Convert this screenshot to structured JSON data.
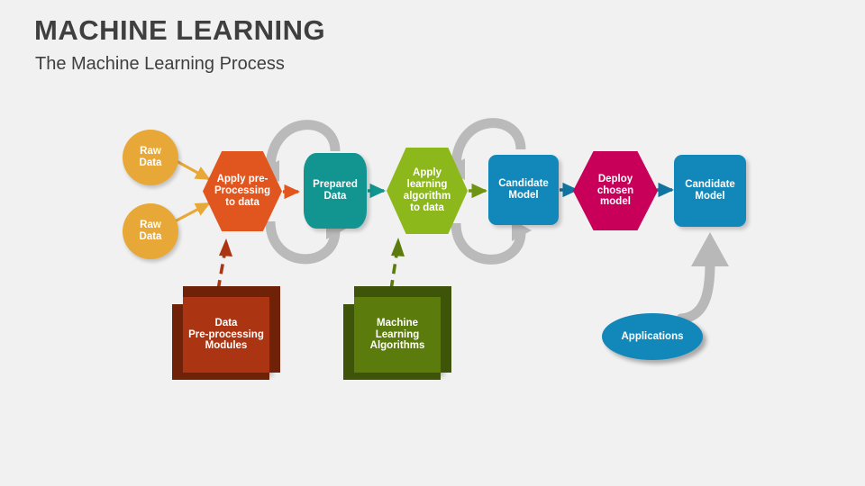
{
  "header": {
    "title": "MACHINE LEARNING",
    "subtitle": "The Machine Learning Process"
  },
  "colors": {
    "background": "#f1f1f1",
    "title_text": "#3f3f3f",
    "raw_data": "#e8a838",
    "preprocess_hex": "#e1561f",
    "prepared_data": "#129490",
    "learning_hex": "#8cb81c",
    "candidate_model": "#1288ba",
    "deploy_hex": "#c8005a",
    "cube_red": "#ab3512",
    "cube_red_dark": "#6f2208",
    "cube_green": "#5b7c0c",
    "cube_green_dark": "#3e5408",
    "applications": "#1288ba",
    "cycle_arrow": "#a6a6a6",
    "node_text": "#ffffff"
  },
  "diagram": {
    "type": "process-flow",
    "nodes": [
      {
        "id": "raw-data-1",
        "label": "Raw\nData",
        "shape": "circle",
        "color": "#e8a838"
      },
      {
        "id": "raw-data-2",
        "label": "Raw\nData",
        "shape": "circle",
        "color": "#e8a838"
      },
      {
        "id": "apply-preprocessing",
        "label": "Apply pre-\nProcessing\nto data",
        "shape": "hexagon",
        "color": "#e1561f"
      },
      {
        "id": "prepared-data",
        "label": "Prepared\nData",
        "shape": "cylinder",
        "color": "#129490"
      },
      {
        "id": "apply-learning-algorithm",
        "label": "Apply\nlearning\nalgorithm\nto data",
        "shape": "hexagon",
        "color": "#8cb81c"
      },
      {
        "id": "candidate-model-1",
        "label": "Candidate\nModel",
        "shape": "rounded-rect",
        "color": "#1288ba"
      },
      {
        "id": "deploy-chosen-model",
        "label": "Deploy\nchosen\nmodel",
        "shape": "hexagon",
        "color": "#c8005a"
      },
      {
        "id": "candidate-model-2",
        "label": "Candidate\nModel",
        "shape": "rounded-rect",
        "color": "#1288ba"
      },
      {
        "id": "data-preprocessing-modules",
        "label": "Data\nPre-processing\nModules",
        "shape": "cube-3d",
        "color": "#ab3512"
      },
      {
        "id": "machine-learning-algorithms",
        "label": "Machine\nLearning\nAlgorithms",
        "shape": "cube-3d",
        "color": "#5b7c0c"
      },
      {
        "id": "applications",
        "label": "Applications",
        "shape": "ellipse",
        "color": "#1288ba"
      }
    ],
    "connectors": [
      {
        "from": "raw-data-1",
        "to": "apply-preprocessing",
        "style": "solid-arrow",
        "color": "#e8a838"
      },
      {
        "from": "raw-data-2",
        "to": "apply-preprocessing",
        "style": "solid-arrow",
        "color": "#e8a838"
      },
      {
        "from": "apply-preprocessing",
        "to": "prepared-data",
        "style": "solid-arrow",
        "color": "#e1561f"
      },
      {
        "from": "prepared-data",
        "to": "apply-learning-algorithm",
        "style": "solid-arrow",
        "color": "#129490"
      },
      {
        "from": "apply-learning-algorithm",
        "to": "candidate-model-1",
        "style": "solid-arrow",
        "color": "#6f9413"
      },
      {
        "from": "candidate-model-1",
        "to": "deploy-chosen-model",
        "style": "solid-arrow",
        "color": "#1073a0"
      },
      {
        "from": "deploy-chosen-model",
        "to": "candidate-model-2",
        "style": "solid-arrow",
        "color": "#1073a0"
      },
      {
        "from": "data-preprocessing-modules",
        "to": "apply-preprocessing",
        "style": "dashed-arrow",
        "color": "#ab3512"
      },
      {
        "from": "machine-learning-algorithms",
        "to": "apply-learning-algorithm",
        "style": "dashed-arrow",
        "color": "#5b7c0c"
      },
      {
        "from": "applications",
        "to": "candidate-model-2",
        "style": "curved-arrow",
        "color": "#a6a6a6"
      },
      {
        "from": "apply-preprocessing",
        "to": "prepared-data",
        "style": "cycle-loop",
        "color": "#a6a6a6"
      },
      {
        "from": "apply-learning-algorithm",
        "to": "candidate-model-1",
        "style": "cycle-loop",
        "color": "#a6a6a6"
      }
    ]
  }
}
